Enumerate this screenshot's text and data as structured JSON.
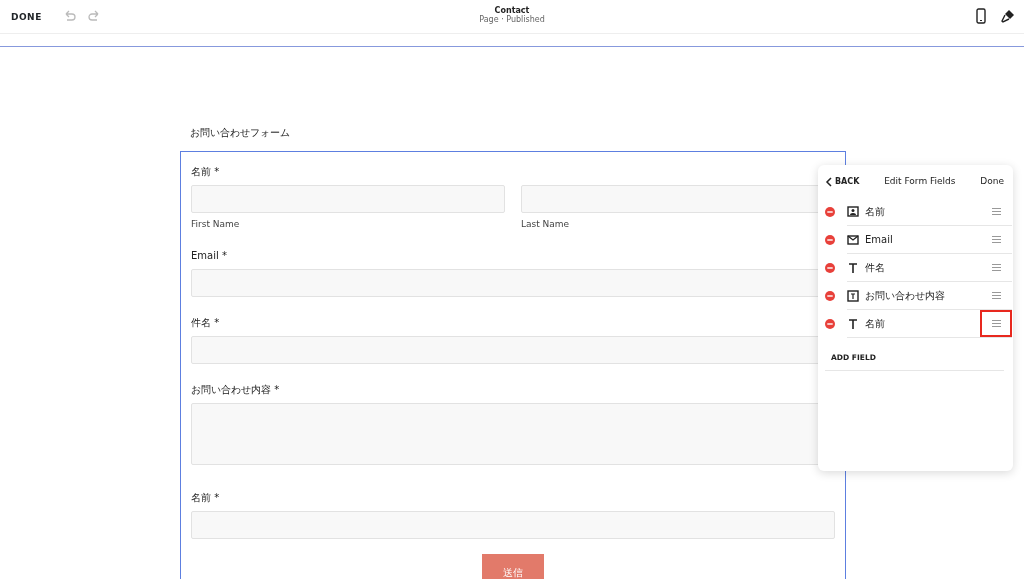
{
  "topbar": {
    "done": "DONE",
    "title": "Contact",
    "subtitle": "Page · Published"
  },
  "form": {
    "title": "お問い合わせフォーム",
    "submit": "送信",
    "fields": [
      {
        "kind": "name",
        "label": "名前 *",
        "sublabels": [
          "First Name",
          "Last Name"
        ]
      },
      {
        "kind": "input",
        "label": "Email *"
      },
      {
        "kind": "input",
        "label": "件名 *"
      },
      {
        "kind": "textarea",
        "label": "お問い合わせ内容 *"
      },
      {
        "kind": "input",
        "label": "名前 *"
      }
    ]
  },
  "panel": {
    "back": "BACK",
    "title": "Edit Form Fields",
    "done": "Done",
    "add": "ADD FIELD",
    "items": [
      {
        "kind": "name",
        "label": "名前",
        "highlighted": false
      },
      {
        "kind": "email",
        "label": "Email",
        "highlighted": false
      },
      {
        "kind": "text",
        "label": "件名",
        "highlighted": false
      },
      {
        "kind": "textarea",
        "label": "お問い合わせ内容",
        "highlighted": false
      },
      {
        "kind": "text",
        "label": "名前",
        "highlighted": true
      }
    ]
  }
}
